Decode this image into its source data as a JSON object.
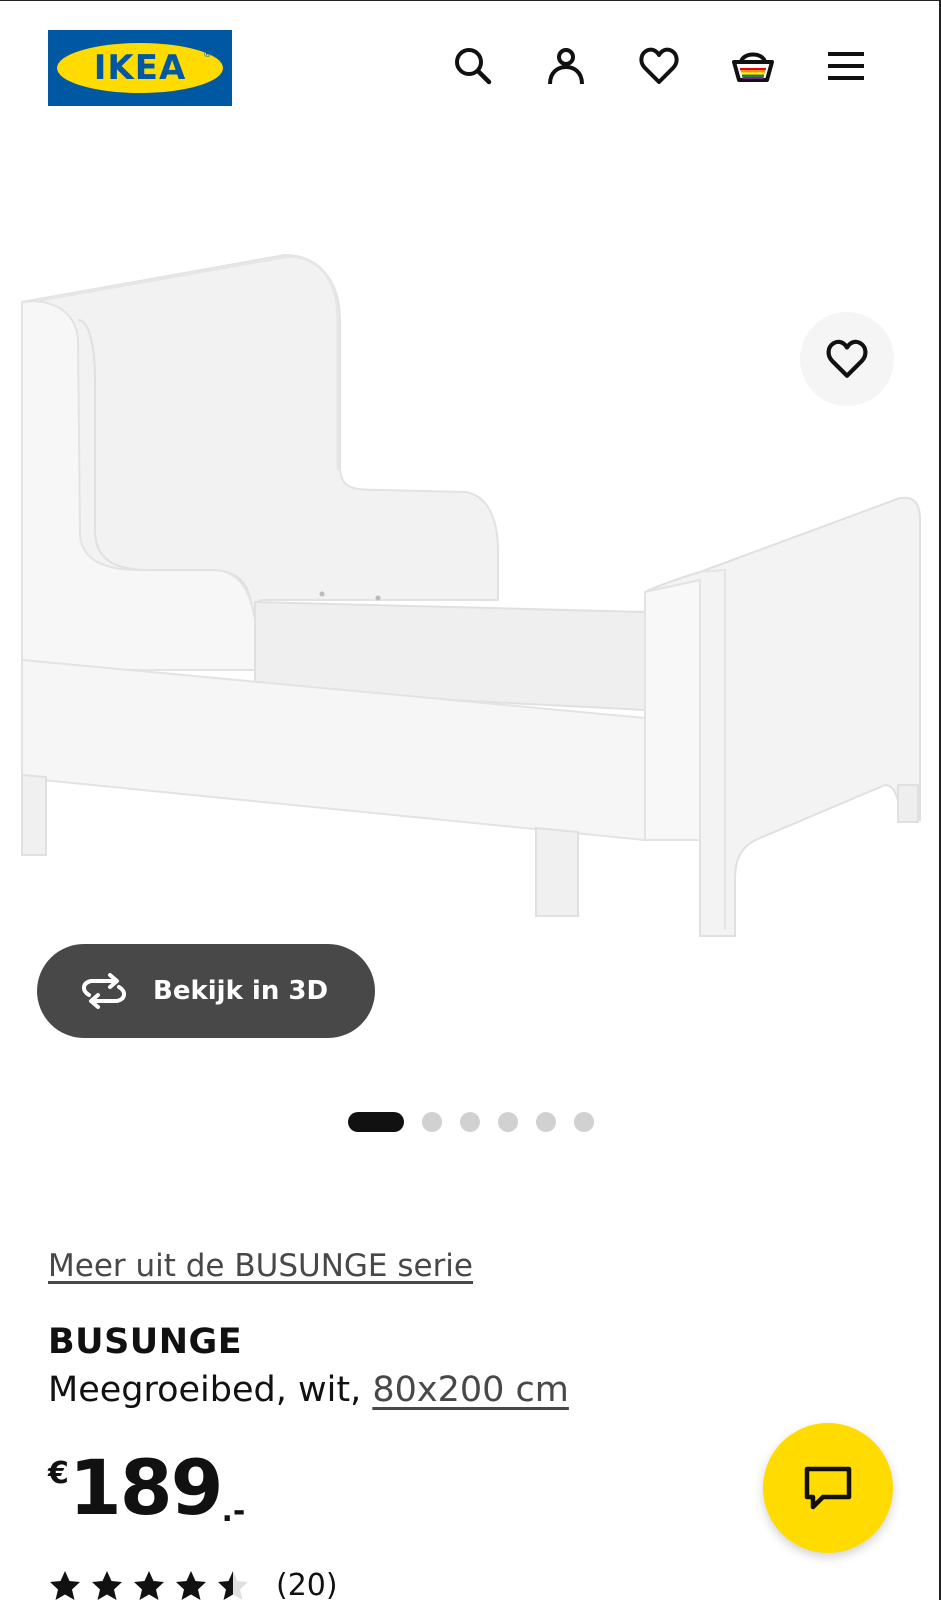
{
  "header": {
    "logo_text": "IKEA",
    "logo_registered": "®",
    "icons": [
      "search-icon",
      "account-icon",
      "heart-icon",
      "cart-icon",
      "menu-icon"
    ]
  },
  "gallery": {
    "favorite_icon": "heart-icon",
    "view_3d_label": "Bekijk in 3D",
    "view_3d_icon": "rotate-icon",
    "slide_count": 6,
    "active_slide": 1
  },
  "product": {
    "series_link": "Meer uit de BUSUNGE serie",
    "name": "BUSUNGE",
    "description": "Meegroeibed, wit,",
    "size": "80x200 cm",
    "price_currency": "€",
    "price_amount": "189",
    "price_decimals": ".-",
    "rating_value": 4.5,
    "rating_max": 5,
    "review_count": "(20)"
  },
  "chat": {
    "icon": "chat-icon"
  },
  "colors": {
    "ikea_blue": "#0058a3",
    "ikea_yellow": "#ffdb00",
    "button_dark": "#484848"
  }
}
